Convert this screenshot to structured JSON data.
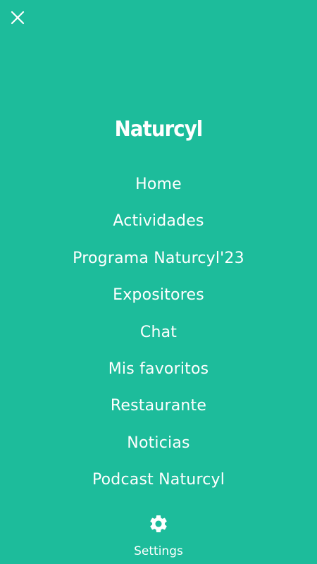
{
  "app": {
    "brand": "Naturcyl",
    "background_color": "#1dbc9b",
    "text_color": "#ffffff"
  },
  "header": {
    "close_icon": "close-icon"
  },
  "menu": {
    "items": [
      {
        "label": "Home"
      },
      {
        "label": "Actividades"
      },
      {
        "label": "Programa Naturcyl'23"
      },
      {
        "label": "Expositores"
      },
      {
        "label": "Chat"
      },
      {
        "label": "Mis favoritos"
      },
      {
        "label": "Restaurante"
      },
      {
        "label": "Noticias"
      },
      {
        "label": "Podcast Naturcyl"
      }
    ]
  },
  "footer": {
    "settings_icon": "gear-icon",
    "settings_label": "Settings"
  }
}
